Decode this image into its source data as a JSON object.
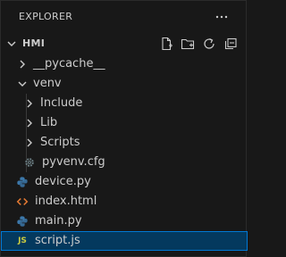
{
  "explorer": {
    "title": "EXPLORER",
    "more_icon": "ellipsis-icon",
    "root": {
      "name": "HMI",
      "actions": [
        "new-file-icon",
        "new-folder-icon",
        "refresh-icon",
        "collapse-all-icon"
      ]
    },
    "tree": [
      {
        "label": "__pycache__",
        "kind": "folder",
        "expanded": false,
        "depth": 1
      },
      {
        "label": "venv",
        "kind": "folder",
        "expanded": true,
        "depth": 1
      },
      {
        "label": "Include",
        "kind": "folder",
        "expanded": false,
        "depth": 2
      },
      {
        "label": "Lib",
        "kind": "folder",
        "expanded": false,
        "depth": 2
      },
      {
        "label": "Scripts",
        "kind": "folder",
        "expanded": false,
        "depth": 2
      },
      {
        "label": "pyvenv.cfg",
        "kind": "config",
        "icon": "gear-icon",
        "depth": 2
      },
      {
        "label": "device.py",
        "kind": "python",
        "icon": "python-icon",
        "depth": 1
      },
      {
        "label": "index.html",
        "kind": "html",
        "icon": "html-icon",
        "depth": 1
      },
      {
        "label": "main.py",
        "kind": "python",
        "icon": "python-icon",
        "depth": 1
      },
      {
        "label": "script.js",
        "kind": "javascript",
        "icon": "js-icon",
        "depth": 1,
        "selected": true
      }
    ],
    "colors": {
      "background": "#181818",
      "text": "#cccccc",
      "selection_bg": "#04395e",
      "selection_border": "#0078d4",
      "python_icon": "#3c78aa",
      "html_icon": "#e37933",
      "js_icon": "#cbcb41",
      "gear_icon": "#6d8086"
    }
  }
}
